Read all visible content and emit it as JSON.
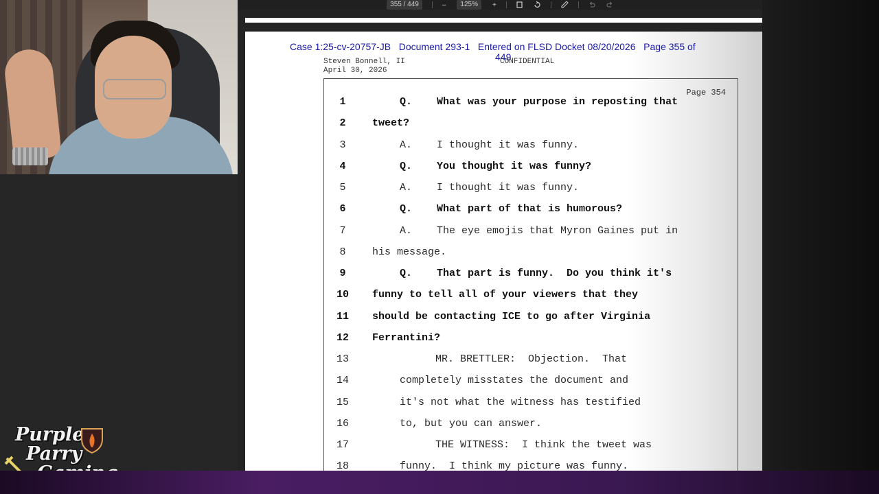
{
  "toolbar": {
    "page_indicator": "355 / 449",
    "zoom_out": "–",
    "zoom_level": "125%",
    "zoom_in": "+",
    "fit_icon": "fit-page-icon",
    "rotate_icon": "rotate-icon",
    "draw_icon": "draw-icon",
    "undo_icon": "undo-icon",
    "redo_icon": "redo-icon"
  },
  "document": {
    "case_header": "Case 1:25-cv-20757-JB   Document 293-1   Entered on FLSD Docket 08/20/2026   Page 355 of",
    "case_header_cont": "449",
    "deponent": "Steven Bonnell, II",
    "date": "April 30, 2026",
    "confidential": "CONFIDENTIAL",
    "page_label": "Page 354",
    "lines": [
      {
        "n": "1",
        "text": "Q.    What was your purpose in reposting that",
        "bold": true,
        "indent": 1
      },
      {
        "n": "2",
        "text": "tweet?",
        "bold": true,
        "indent": 0
      },
      {
        "n": "3",
        "text": "A.    I thought it was funny.",
        "bold": false,
        "indent": 1
      },
      {
        "n": "4",
        "text": "Q.    You thought it was funny?",
        "bold": true,
        "indent": 1
      },
      {
        "n": "5",
        "text": "A.    I thought it was funny.",
        "bold": false,
        "indent": 1
      },
      {
        "n": "6",
        "text": "Q.    What part of that is humorous?",
        "bold": true,
        "indent": 1
      },
      {
        "n": "7",
        "text": "A.    The eye emojis that Myron Gaines put in",
        "bold": false,
        "indent": 1
      },
      {
        "n": "8",
        "text": "his message.",
        "bold": false,
        "indent": 0
      },
      {
        "n": "9",
        "text": "Q.    That part is funny.  Do you think it's",
        "bold": true,
        "indent": 1
      },
      {
        "n": "10",
        "text": "funny to tell all of your viewers that they",
        "bold": true,
        "indent": 0
      },
      {
        "n": "11",
        "text": "should be contacting ICE to go after Virginia",
        "bold": true,
        "indent": 0
      },
      {
        "n": "12",
        "text": "Ferrantini?",
        "bold": true,
        "indent": 0
      },
      {
        "n": "13",
        "text": "MR. BRETTLER:  Objection.  That",
        "bold": false,
        "indent": 2
      },
      {
        "n": "14",
        "text": "completely misstates the document and",
        "bold": false,
        "indent": 1
      },
      {
        "n": "15",
        "text": "it's not what the witness has testified",
        "bold": false,
        "indent": 1
      },
      {
        "n": "16",
        "text": "to, but you can answer.",
        "bold": false,
        "indent": 1
      },
      {
        "n": "17",
        "text": "THE WITNESS:  I think the tweet was",
        "bold": false,
        "indent": 2
      },
      {
        "n": "18",
        "text": "funny.  I think my picture was funny.",
        "bold": false,
        "indent": 1
      }
    ]
  },
  "logo": {
    "line1": "Purple",
    "line2": "Parry",
    "line3": "Gaming",
    "icon": "sword-shield-icon"
  },
  "colors": {
    "header_blue": "#1a1aa8",
    "accent_purple": "#4a1d63"
  }
}
